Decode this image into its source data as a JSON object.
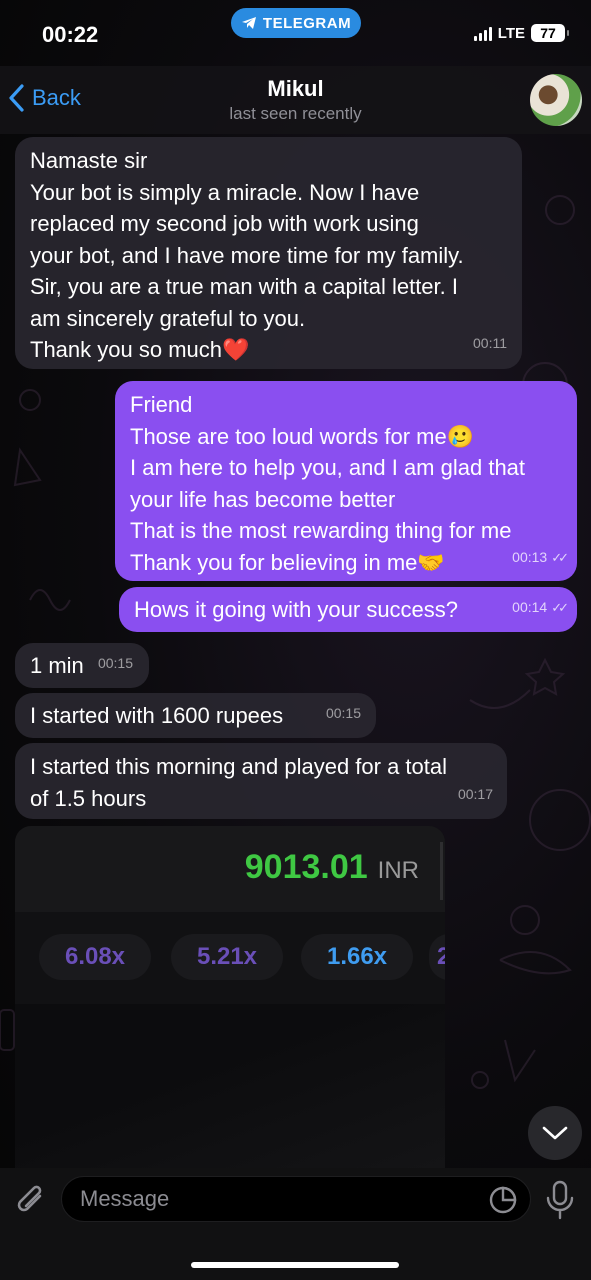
{
  "status_bar": {
    "time": "00:22",
    "app_pill": "TELEGRAM",
    "network": "LTE",
    "battery": "77"
  },
  "header": {
    "back_label": "Back",
    "contact_name": "Mikul",
    "contact_status": "last seen recently"
  },
  "messages": [
    {
      "direction": "incoming",
      "lines": [
        "Namaste sir",
        "Your bot is simply a miracle. Now I have",
        "replaced my second job with work using",
        "your bot, and I have more time for my family.",
        "Sir, you are a true man with a capital letter. I",
        "am sincerely grateful to you.",
        "Thank you so much❤️"
      ],
      "time": "00:11"
    },
    {
      "direction": "outgoing",
      "lines": [
        "Friend",
        "Those are too loud words for me🥲",
        "I am here to help you, and I am glad that",
        "your life has become better",
        "That is the most rewarding thing for me",
        "Thank you for believing in me🤝"
      ],
      "time": "00:13",
      "read": true
    },
    {
      "direction": "outgoing",
      "lines": [
        "Hows it going with your success?"
      ],
      "time": "00:14",
      "read": true
    },
    {
      "direction": "incoming",
      "lines": [
        "1 min"
      ],
      "time": "00:15"
    },
    {
      "direction": "incoming",
      "lines": [
        "I started with 1600 rupees"
      ],
      "time": "00:15"
    },
    {
      "direction": "incoming",
      "lines": [
        "I started this morning and played for a total",
        "of 1.5 hours"
      ],
      "time": "00:17"
    }
  ],
  "image_message": {
    "balance_value": "9013.01",
    "balance_currency": "INR",
    "multipliers": [
      {
        "label": "6.08x",
        "color": "#6a4fb8"
      },
      {
        "label": "5.21x",
        "color": "#6a4fb8"
      },
      {
        "label": "1.66x",
        "color": "#3f9cf0"
      },
      {
        "label": "2",
        "color": "#6a4fb8"
      }
    ]
  },
  "input": {
    "placeholder": "Message"
  },
  "colors": {
    "accent": "#3b9cf5",
    "outgoing_bubble": "#8a4ff0",
    "incoming_bubble": "#28262e",
    "balance_green": "#3fc843"
  }
}
